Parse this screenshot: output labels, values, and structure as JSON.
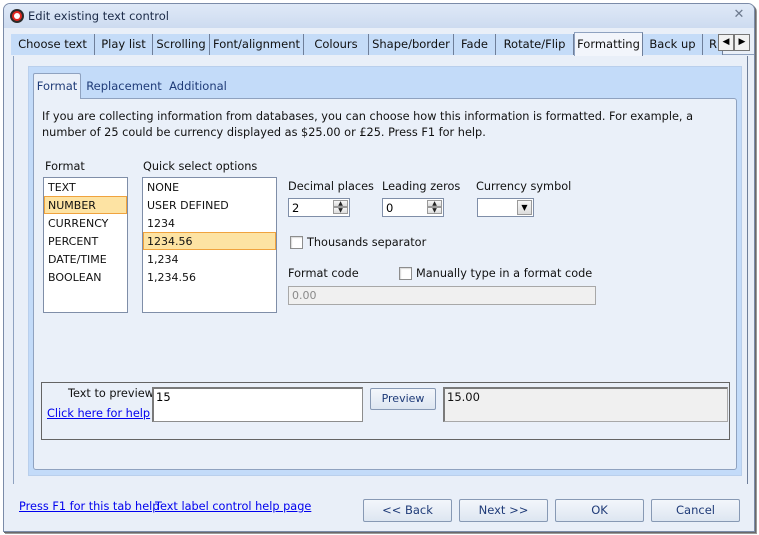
{
  "window": {
    "title": "Edit existing text control",
    "close_glyph": "✕"
  },
  "tabs": [
    {
      "label": "Choose text",
      "active": false
    },
    {
      "label": "Play list",
      "active": false
    },
    {
      "label": "Scrolling",
      "active": false
    },
    {
      "label": "Font/alignment",
      "active": false
    },
    {
      "label": "Colours",
      "active": false
    },
    {
      "label": "Shape/border",
      "active": false
    },
    {
      "label": "Fade",
      "active": false
    },
    {
      "label": "Rotate/Flip",
      "active": false
    },
    {
      "label": "Formatting",
      "active": true
    },
    {
      "label": "Back up",
      "active": false
    },
    {
      "label": "R",
      "active": false
    }
  ],
  "tab_scroll": {
    "left": "◀",
    "right": "▶"
  },
  "subtabs": [
    {
      "label": "Format",
      "active": true
    },
    {
      "label": "Replacement",
      "active": false
    },
    {
      "label": "Additional",
      "active": false
    }
  ],
  "format_panel": {
    "description": "If you are collecting information from databases, you can choose how this information is formatted.  For example, a number of 25 could be currency displayed as $25.00 or £25.  Press F1 for help.",
    "format_label": "Format",
    "format_items": [
      "TEXT",
      "NUMBER",
      "CURRENCY",
      "PERCENT",
      "DATE/TIME",
      "BOOLEAN"
    ],
    "format_selected": "NUMBER",
    "quick_label": "Quick select options",
    "quick_items": [
      "NONE",
      "USER DEFINED",
      "1234",
      "1234.56",
      "1,234",
      "1,234.56"
    ],
    "quick_selected": "1234.56",
    "decimal_places_label": "Decimal places",
    "decimal_places_value": "2",
    "leading_zeros_label": "Leading zeros",
    "leading_zeros_value": "0",
    "currency_symbol_label": "Currency symbol",
    "currency_symbol_value": "",
    "thousands_label": "Thousands separator",
    "thousands_checked": false,
    "format_code_label": "Format code",
    "manual_label": "Manually type in a format code",
    "manual_checked": false,
    "format_code_value": "0.00",
    "spin_up": "▲",
    "spin_down": "▼",
    "combo_arrow": "▼"
  },
  "preview": {
    "label": "Text to preview",
    "help_link": "Click here for help",
    "input_value": "15",
    "button_label": "Preview",
    "output_value": "15.00"
  },
  "footer": {
    "link_tab_help": "Press F1 for this tab help",
    "link_control_help": "Text label control help page",
    "back_label": "<< Back",
    "next_label": "Next >>",
    "ok_label": "OK",
    "cancel_label": "Cancel"
  },
  "colors": {
    "tab_bg": "#c5dcf8",
    "panel_bg": "#eaf0f9",
    "selection_bg": "#fde3a3",
    "selection_border": "#f0a33e",
    "link": "#0000ee"
  }
}
